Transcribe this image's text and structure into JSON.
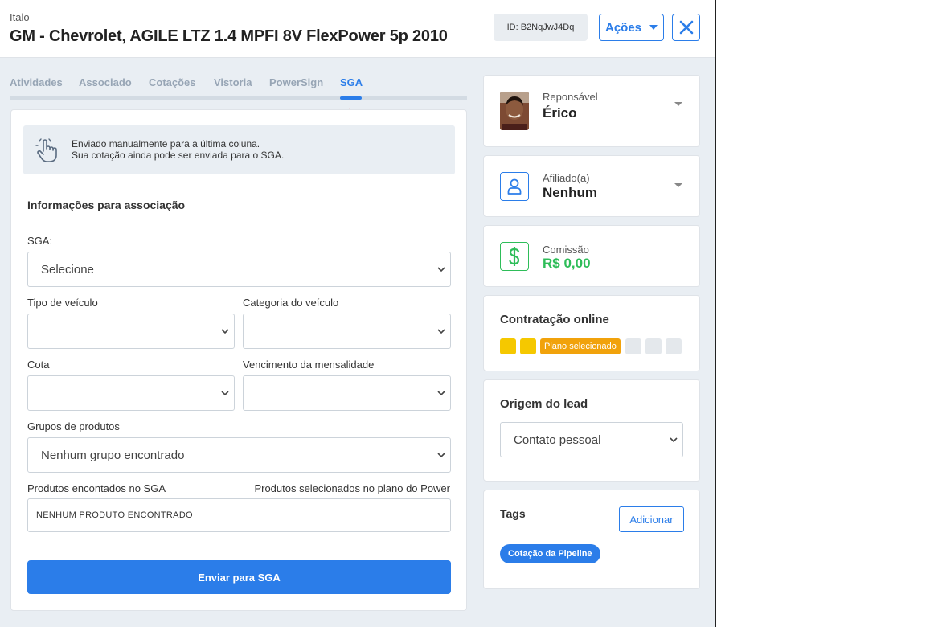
{
  "header": {
    "owner": "Italo",
    "title": "GM - Chevrolet, AGILE LTZ 1.4 MPFI 8V FlexPower 5p 2010",
    "id_badge": "ID: B2NqJwJ4Dq",
    "actions_label": "Ações"
  },
  "tabs": [
    {
      "label": "Atividades",
      "active": false
    },
    {
      "label": "Associado",
      "active": false
    },
    {
      "label": "Cotações",
      "active": false
    },
    {
      "label": "Vistoria",
      "active": false
    },
    {
      "label": "PowerSign",
      "active": false
    },
    {
      "label": "SGA",
      "active": true
    }
  ],
  "sga": {
    "info_line1": "Enviado manualmente para a última coluna.",
    "info_line2": "Sua cotação ainda pode ser enviada para o SGA.",
    "section_title": "Informações para associação",
    "sga_label": "SGA:",
    "sga_value": "Selecione",
    "vehicle_type_label": "Tipo de veículo",
    "vehicle_type_value": "",
    "vehicle_category_label": "Categoria do veículo",
    "vehicle_category_value": "",
    "quota_label": "Cota",
    "quota_value": "",
    "due_label": "Vencimento da mensalidade",
    "due_value": "",
    "groups_label": "Grupos de produtos",
    "groups_value": "Nenhum grupo encontrado",
    "products_sga_label": "Produtos encontados no SGA",
    "products_selected_label": "Produtos selecionados no plano do Power",
    "products_value": "NENHUM PRODUTO ENCONTRADO",
    "send_button": "Enviar para SGA"
  },
  "sidebar": {
    "responsible_label": "Reponsável",
    "responsible_value": "Érico",
    "affiliate_label": "Afiliado(a)",
    "affiliate_value": "Nenhum",
    "commission_label": "Comissão",
    "commission_value": "R$ 0,00",
    "online_title": "Contratação online",
    "online_step_label": "Plano selecionado",
    "origin_title": "Origem do lead",
    "origin_value": "Contato pessoal",
    "tags_title": "Tags",
    "tags_add": "Adicionar",
    "tags": [
      "Cotação da Pipeline"
    ]
  },
  "colors": {
    "accent": "#2b7de9",
    "money_green": "#2ebd59",
    "step_yellow": "#f5c800",
    "step_orange": "#f1a20b",
    "step_grey": "#e4e8ec",
    "highlight_arrow": "#e01a22"
  },
  "icons": {
    "close": "close-icon",
    "hand": "hand-pointer-icon",
    "user": "user-icon",
    "dollar": "dollar-icon"
  }
}
